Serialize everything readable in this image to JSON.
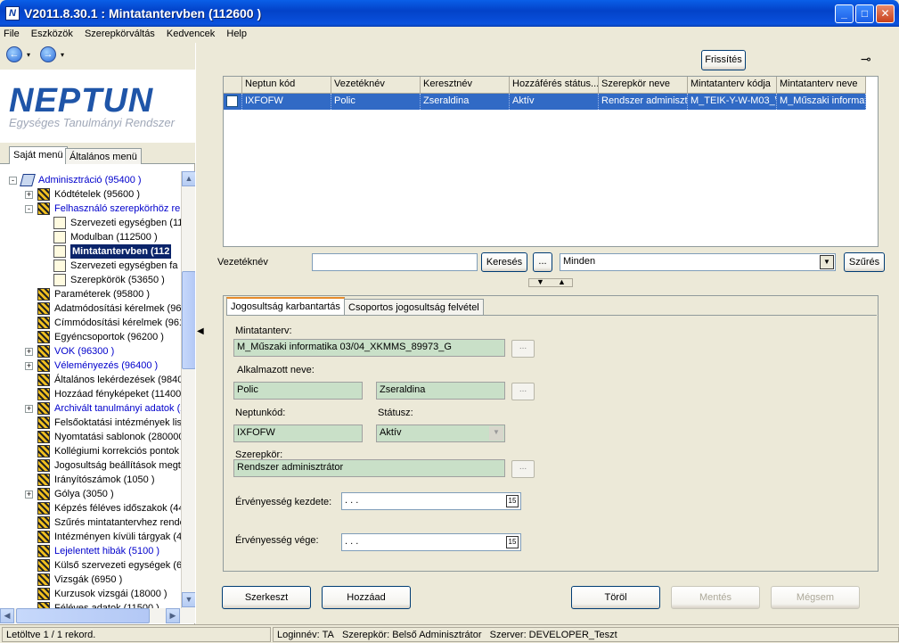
{
  "window": {
    "title": "V2011.8.30.1 : Mintatantervben (112600  )",
    "app_icon_letter": "N",
    "minimize_glyph": "_",
    "maximize_glyph": "□",
    "close_glyph": "✕"
  },
  "menu": [
    "File",
    "Eszközök",
    "Szerepkörváltás",
    "Kedvencek",
    "Help"
  ],
  "nav": {
    "back_glyph": "←",
    "forward_glyph": "→",
    "dropdown_glyph": "▾"
  },
  "logo": {
    "name": "NEPTUN",
    "subtitle": "Egységes Tanulmányi Rendszer"
  },
  "left_tabs": [
    "Saját menü",
    "Általános menü"
  ],
  "tree": [
    {
      "label": "Adminisztráció (95400  )",
      "level": 0,
      "expander": "-",
      "icon": "book",
      "blue": true
    },
    {
      "label": "Kódtételek (95600  )",
      "level": 1,
      "expander": "+",
      "icon": "std"
    },
    {
      "label": "Felhasználó szerepkörhöz ren",
      "level": 1,
      "expander": "-",
      "icon": "std",
      "blue": true
    },
    {
      "label": "Szervezeti egységben (11",
      "level": 2,
      "icon": "doc"
    },
    {
      "label": "Modulban (112500  )",
      "level": 2,
      "icon": "doc"
    },
    {
      "label": "Mintatantervben (112",
      "level": 2,
      "icon": "doc",
      "selected": true
    },
    {
      "label": "Szervezeti egységben fa",
      "level": 2,
      "icon": "doc"
    },
    {
      "label": "Szerepkörök (53650  )",
      "level": 2,
      "icon": "doc"
    },
    {
      "label": "Paraméterek (95800  )",
      "level": 1,
      "icon": "std"
    },
    {
      "label": "Adatmódosítási kérelmek (96",
      "level": 1,
      "icon": "std"
    },
    {
      "label": "Címmódosítási kérelmek (961",
      "level": 1,
      "icon": "std"
    },
    {
      "label": "Egyéncsoportok (96200  )",
      "level": 1,
      "icon": "std"
    },
    {
      "label": "VOK (96300  )",
      "level": 1,
      "expander": "+",
      "icon": "std",
      "blue": true
    },
    {
      "label": "Véleményezés (96400  )",
      "level": 1,
      "expander": "+",
      "icon": "std",
      "blue": true
    },
    {
      "label": "Általános lekérdezések (9840",
      "level": 1,
      "icon": "std"
    },
    {
      "label": "Hozzáad fényképeket (11400",
      "level": 1,
      "icon": "std"
    },
    {
      "label": "Archivált tanulmányi adatok (2",
      "level": 1,
      "expander": "+",
      "icon": "std",
      "blue": true
    },
    {
      "label": "Felsőoktatási intézmények list",
      "level": 1,
      "icon": "std"
    },
    {
      "label": "Nyomtatási sablonok (280000",
      "level": 1,
      "icon": "std"
    },
    {
      "label": "Kollégiumi korrekciós pontok",
      "level": 1,
      "icon": "std"
    },
    {
      "label": "Jogosultság beállítások megt",
      "level": 1,
      "icon": "std"
    },
    {
      "label": "Irányítószámok (1050  )",
      "level": 1,
      "icon": "std"
    },
    {
      "label": "Gólya (3050  )",
      "level": 1,
      "expander": "+",
      "icon": "std"
    },
    {
      "label": "Képzés féléves időszakok (44",
      "level": 1,
      "icon": "std"
    },
    {
      "label": "Szűrés mintatantervhez rende",
      "level": 1,
      "icon": "std"
    },
    {
      "label": "Intézményen kívüli tárgyak (4",
      "level": 1,
      "icon": "std"
    },
    {
      "label": "Lejelentett hibák (5100  )",
      "level": 1,
      "icon": "std",
      "blue": true
    },
    {
      "label": "Külső szervezeti egységek (68",
      "level": 1,
      "icon": "std"
    },
    {
      "label": "Vizsgák (6950  )",
      "level": 1,
      "icon": "std"
    },
    {
      "label": "Kurzusok vizsgái (18000  )",
      "level": 1,
      "icon": "std"
    },
    {
      "label": "Féléves adatok (11500  )",
      "level": 1,
      "icon": "std"
    }
  ],
  "scroll": {
    "up": "▲",
    "down": "▼",
    "left": "◀",
    "right": "▶"
  },
  "splitter_glyph": "◀",
  "toolbar": {
    "refresh": "Frissítés",
    "pin_glyph": "⊸"
  },
  "grid": {
    "headers": [
      "Neptun kód",
      "Vezetéknév",
      "Keresztnév",
      "Hozzáférés státus...",
      "Szerepkör neve",
      "Mintatanterv kódja",
      "Mintatanterv neve"
    ],
    "rows": [
      [
        "IXFOFW",
        "Polic",
        "Zseraldina",
        "Aktív",
        "Rendszer adminisztrá",
        "M_TEIK-Y-W-M03_\\",
        "M_Műszaki informati"
      ]
    ]
  },
  "search": {
    "field_label": "Vezetéknév",
    "value": "",
    "search_button": "Keresés",
    "ellipsis": "...",
    "filter_value": "Minden",
    "dropdown_glyph": "▼",
    "filter_button": "Szűrés"
  },
  "collapse": {
    "down": "▼",
    "up": "▲"
  },
  "detail_tabs": [
    "Jogosultság karbantartás",
    "Csoportos jogosultság felvétel"
  ],
  "form": {
    "curriculum_label": "Mintatanterv:",
    "curriculum_value": "M_Műszaki informatika 03/04_XKMMS_89973_G",
    "employee_label": "Alkalmazott neve:",
    "last_name": "Polic",
    "first_name": "Zseraldina",
    "neptun_label": "Neptunkód:",
    "neptun_value": "IXFOFW",
    "status_label": "Státusz:",
    "status_value": "Aktív",
    "role_label": "Szerepkör:",
    "role_value": "Rendszer adminisztrátor",
    "valid_from_label": "Érvényesség kezdete:",
    "valid_from_value": " .   .   .",
    "valid_to_label": "Érvényesség vége:",
    "valid_to_value": " .   .   .",
    "calendar_glyph": "15",
    "ellipsis": "..."
  },
  "actions": {
    "edit": "Szerkeszt",
    "add": "Hozzáad",
    "delete": "Töröl",
    "save": "Mentés",
    "cancel": "Mégsem"
  },
  "status": {
    "records": "Letöltve 1 / 1 rekord.",
    "login": "Loginnév: TA",
    "role": "Szerepkör: Belső Adminisztrátor",
    "server": "Szerver: DEVELOPER_Teszt"
  }
}
